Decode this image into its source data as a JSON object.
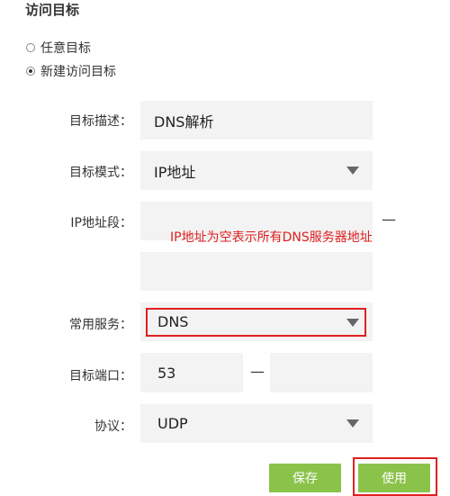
{
  "section": {
    "title": "访问目标"
  },
  "radios": [
    {
      "label": "任意目标",
      "checked": false
    },
    {
      "label": "新建访问目标",
      "checked": true
    }
  ],
  "fields": {
    "description": {
      "label": "目标描述：",
      "value": "DNS解析"
    },
    "mode": {
      "label": "目标模式：",
      "value": "IP地址"
    },
    "ip_range": {
      "label": "IP地址段：",
      "start": "",
      "end": "",
      "dash": "—"
    },
    "service": {
      "label": "常用服务：",
      "value": "DNS"
    },
    "port": {
      "label": "目标端口：",
      "start": "53",
      "end": "",
      "dash": "—"
    },
    "protocol": {
      "label": "协议：",
      "value": "UDP"
    }
  },
  "annotation": {
    "text": "IP地址为空表示所有DNS服务器地址",
    "color": "#e02020"
  },
  "buttons": {
    "save": "保存",
    "apply": "使用"
  },
  "colors": {
    "button": "#8bc34a",
    "highlight": "#e02020",
    "field_bg": "#f3f3f3"
  }
}
